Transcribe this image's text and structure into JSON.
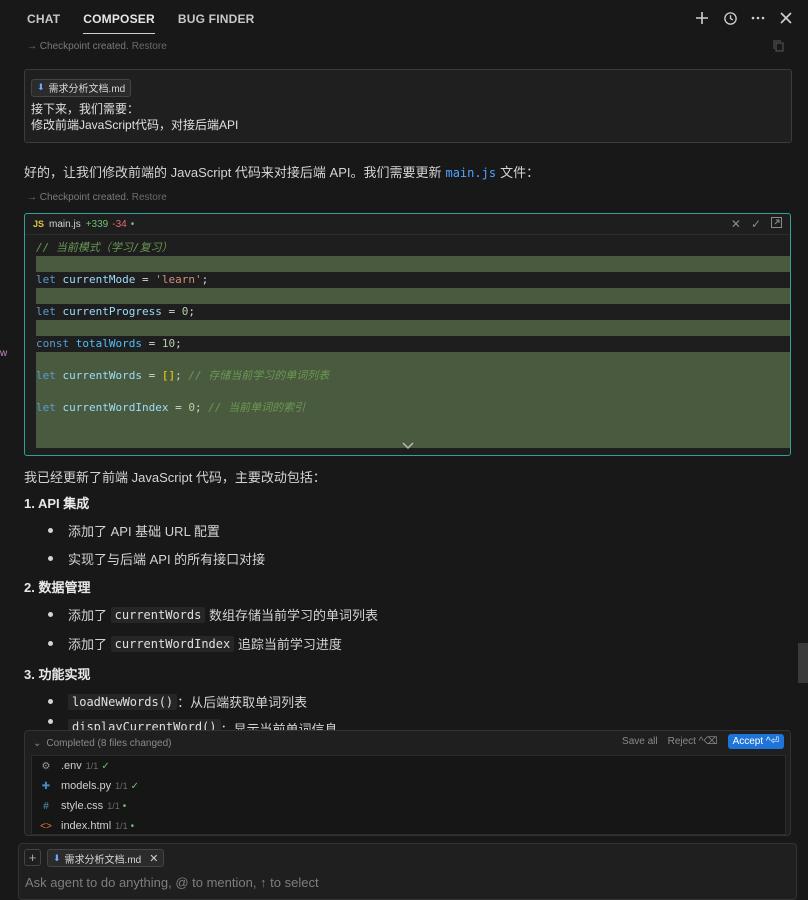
{
  "header": {
    "tabs": [
      {
        "label": "CHAT",
        "active": false
      },
      {
        "label": "COMPOSER",
        "active": true
      },
      {
        "label": "BUG FINDER",
        "active": false
      }
    ]
  },
  "checkpoint1": {
    "text": "Checkpoint created.",
    "restore": "Restore"
  },
  "user_message": {
    "attachment": "需求分析文档.md",
    "lines": [
      "接下来，我们需要：",
      "修改前端JavaScript代码，对接后端API"
    ]
  },
  "reply_intro": {
    "before": "好的，让我们修改前端的 JavaScript 代码来对接后端 API。我们需要更新",
    "code": "main.js",
    "after": "文件："
  },
  "checkpoint2": {
    "text": "Checkpoint created.",
    "restore": "Restore"
  },
  "code_block": {
    "badge": "JS",
    "filename": "main.js",
    "added": "+339",
    "removed": "-34",
    "lines": {
      "l0": "// 当前模式（学习/复习）",
      "l2_kw": "let",
      "l2_var": "currentMode",
      "l2_op": " = ",
      "l2_val": "'learn'",
      "l2_end": ";",
      "l4_kw": "let",
      "l4_var": "currentProgress",
      "l4_op": " = ",
      "l4_val": "0",
      "l4_end": ";",
      "l6_kw": "const",
      "l6_var": "totalWords",
      "l6_op": " = ",
      "l6_val": "10",
      "l6_end": ";",
      "l8_kw": "let",
      "l8_var": "currentWords",
      "l8_op": " = ",
      "l8_val": "[]",
      "l8_end": ";",
      "l8_cm": "// 存储当前学习的单词列表",
      "l10_kw": "let",
      "l10_var": "currentWordIndex",
      "l10_op": " = ",
      "l10_val": "0",
      "l10_end": ";",
      "l10_cm": "// 当前单词的索引"
    }
  },
  "explanation": {
    "intro": "我已经更新了前端 JavaScript 代码，主要改动包括：",
    "s1": "1. API 集成",
    "s1_b1": "添加了 API 基础 URL 配置",
    "s1_b2": "实现了与后端 API 的所有接口对接",
    "s2": "2. 数据管理",
    "s2_b1_pre": "添加了",
    "s2_b1_code": "currentWords",
    "s2_b1_post": "数组存储当前学习的单词列表",
    "s2_b2_pre": "添加了",
    "s2_b2_code": "currentWordIndex",
    "s2_b2_post": "追踪当前学习进度",
    "s3": "3. 功能实现",
    "s3_b1_code": "loadNewWords()",
    "s3_b1_post": "：从后端获取单词列表",
    "s3_b2_code": "displayCurrentWord()",
    "s3_b2_post": "：显示当前单词信息"
  },
  "completed": {
    "label": "Completed",
    "count": "(8 files changed)",
    "save_all": "Save all",
    "reject": "Reject ^⌫",
    "accept": "Accept ^⏎",
    "files": [
      {
        "name": ".env",
        "count": "1/1",
        "status": "✓"
      },
      {
        "name": "models.py",
        "count": "1/1",
        "status": "✓"
      },
      {
        "name": "style.css",
        "count": "1/1",
        "status": "•"
      },
      {
        "name": "index.html",
        "count": "1/1",
        "status": "•"
      }
    ]
  },
  "input": {
    "attachment": "需求分析文档.md",
    "placeholder": "Ask agent to do anything, @ to mention, ↑ to select"
  },
  "colors": {
    "accent": "#1e74d8",
    "code_border": "#2fa39a",
    "added_bg": "#4a5a3e"
  }
}
